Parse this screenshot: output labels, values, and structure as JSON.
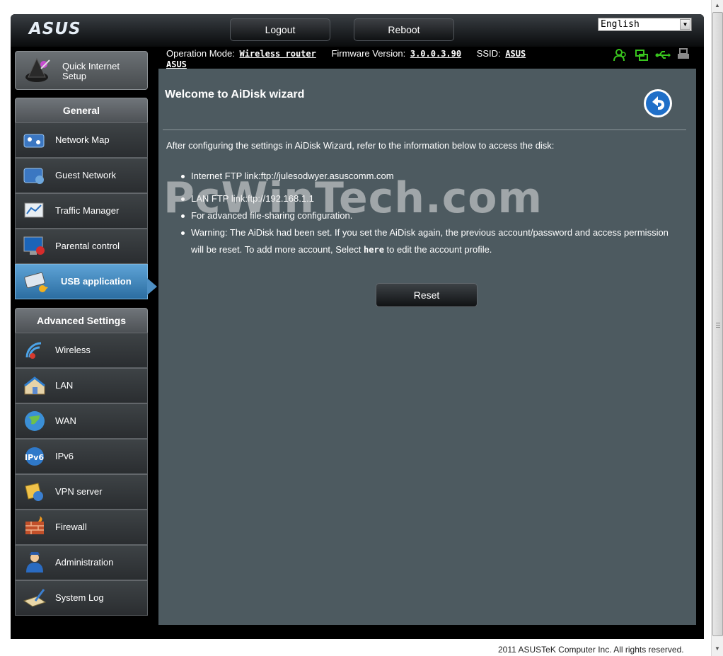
{
  "header": {
    "logo": "ASUS",
    "logout_label": "Logout",
    "reboot_label": "Reboot",
    "language": "English"
  },
  "status": {
    "operation_mode_label": "Operation Mode:",
    "operation_mode_value": "Wireless router",
    "firmware_label": "Firmware Version:",
    "firmware_value": "3.0.0.3.90",
    "ssid_label": "SSID:",
    "ssid_values": [
      "ASUS",
      "ASUS"
    ],
    "icons": [
      "clients-icon",
      "network-icon",
      "usb-icon",
      "printer-icon"
    ],
    "icon_color": "#39c51e"
  },
  "sidebar": {
    "quick_setup_label": "Quick Internet Setup",
    "general_header": "General",
    "general_items": [
      {
        "label": "Network Map",
        "icon": "network-map-icon"
      },
      {
        "label": "Guest Network",
        "icon": "guest-network-icon"
      },
      {
        "label": "Traffic Manager",
        "icon": "traffic-manager-icon"
      },
      {
        "label": "Parental control",
        "icon": "parental-control-icon"
      },
      {
        "label": "USB application",
        "icon": "usb-application-icon",
        "active": true
      }
    ],
    "advanced_header": "Advanced Settings",
    "advanced_items": [
      {
        "label": "Wireless",
        "icon": "wireless-icon"
      },
      {
        "label": "LAN",
        "icon": "lan-icon"
      },
      {
        "label": "WAN",
        "icon": "wan-icon"
      },
      {
        "label": "IPv6",
        "icon": "ipv6-icon"
      },
      {
        "label": "VPN server",
        "icon": "vpn-server-icon"
      },
      {
        "label": "Firewall",
        "icon": "firewall-icon"
      },
      {
        "label": "Administration",
        "icon": "administration-icon"
      },
      {
        "label": "System Log",
        "icon": "system-log-icon"
      }
    ],
    "active_color": "#3d85bd"
  },
  "main": {
    "title": "Welcome to AiDisk wizard",
    "intro": "After configuring the settings in AiDisk Wizard, refer to the information below to access the disk:",
    "bullet_internet_ftp": "Internet FTP link:ftp://julesodwyer.asuscomm.com",
    "bullet_lan_ftp": "LAN FTP link:ftp://192.168.1.1",
    "bullet_advanced": "For advanced file-sharing configuration.",
    "bullet_warning_1": "Warning: The AiDisk had been set. If you set the AiDisk again, the previous account/password and access permission will be reset. To add more account, Select",
    "bullet_warning_link": "here",
    "bullet_warning_2": "to edit the account profile.",
    "reset_label": "Reset",
    "panel_color": "#4d5a60"
  },
  "watermark": "PcWinTech.com",
  "footer": "2011 ASUSTeK Computer Inc. All rights reserved."
}
